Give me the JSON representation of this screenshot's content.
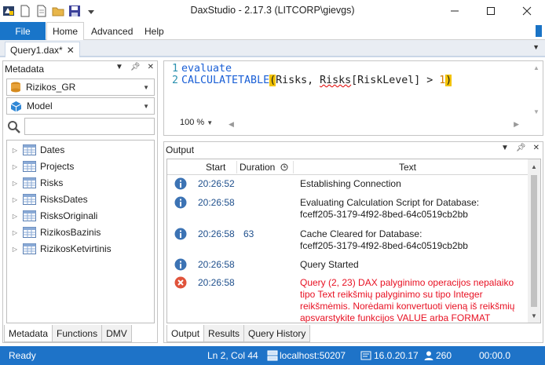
{
  "window": {
    "title": "DaxStudio - 2.17.3 (LITCORP\\gievgs)"
  },
  "ribbon": {
    "file": "File",
    "tabs": [
      "Home",
      "Advanced",
      "Help"
    ]
  },
  "document_tab": {
    "label": "Query1.dax*",
    "close": "✕"
  },
  "metadata": {
    "title": "Metadata",
    "database": "Rizikos_GR",
    "model": "Model",
    "search_placeholder": "",
    "tables": [
      "Dates",
      "Projects",
      "Risks",
      "RisksDates",
      "RisksOriginali",
      "RizikosBazinis",
      "RizikosKetvirtinis"
    ],
    "tabs": [
      "Metadata",
      "Functions",
      "DMV"
    ]
  },
  "editor": {
    "line_numbers": [
      "1",
      "2"
    ],
    "line1_keyword": "evaluate",
    "line2": {
      "func": "CALCULATETABLE",
      "open_paren": "(",
      "arg1": "Risks, ",
      "squiggle": "Risks",
      "rest": "[RiskLevel] > ",
      "number": "1",
      "close_paren": ")"
    },
    "zoom": "100 %"
  },
  "output": {
    "title": "Output",
    "columns": {
      "start": "Start",
      "duration": "Duration",
      "text": "Text"
    },
    "rows": [
      {
        "type": "info",
        "start": "20:26:52",
        "duration": "",
        "lines": [
          "Establishing Connection"
        ]
      },
      {
        "type": "info",
        "start": "20:26:58",
        "duration": "",
        "lines": [
          "Evaluating Calculation Script for Database:",
          "fceff205-3179-4f92-8bed-64c0519cb2bb"
        ]
      },
      {
        "type": "info",
        "start": "20:26:58",
        "duration": "63",
        "lines": [
          "Cache Cleared for Database:",
          "fceff205-3179-4f92-8bed-64c0519cb2bb"
        ]
      },
      {
        "type": "info",
        "start": "20:26:58",
        "duration": "",
        "lines": [
          "Query Started"
        ]
      },
      {
        "type": "error",
        "start": "20:26:58",
        "duration": "",
        "lines": [
          "Query (2, 23) DAX palyginimo operacijos nepalaiko",
          "tipo Text reikšmių palyginimo su tipo Integer",
          "reikšmėmis. Norėdami konvertuoti vieną iš reikšmių",
          "apsvarstykite funkcijos VALUE arba FORMAT"
        ]
      }
    ],
    "tabs": [
      "Output",
      "Results",
      "Query History"
    ]
  },
  "status": {
    "ready": "Ready",
    "position": "Ln 2, Col 44",
    "server": "localhost:50207",
    "version": "16.0.20.17",
    "spid": "260",
    "timer": "00:00.0"
  },
  "colors": {
    "accent": "#1e73c8",
    "error": "#e81123",
    "info": "#3c73b4",
    "keyword": "#1a5fd6",
    "bracket_highlight": "#f2c200"
  }
}
